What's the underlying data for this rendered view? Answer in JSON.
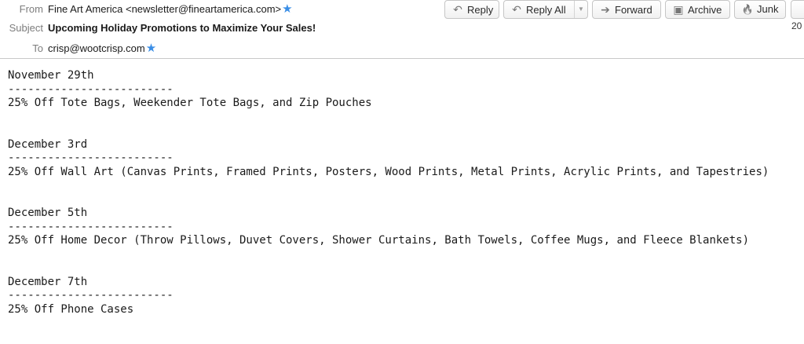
{
  "header": {
    "from_label": "From",
    "from_value": "Fine Art America <newsletter@fineartamerica.com>",
    "subject_label": "Subject",
    "subject_value": "Upcoming Holiday Promotions to Maximize Your Sales!",
    "to_label": "To",
    "to_value": "crisp@wootcrisp.com",
    "star_icon": "★",
    "date_fragment": "20",
    "accent_color": "#3a8ee6"
  },
  "toolbar": {
    "reply": {
      "label": "Reply",
      "icon": "reply-icon",
      "glyph": "↶"
    },
    "reply_all": {
      "label": "Reply All",
      "icon": "reply-all-icon",
      "glyph": "↶"
    },
    "forward": {
      "label": "Forward",
      "icon": "forward-icon",
      "glyph": "➔"
    },
    "archive": {
      "label": "Archive",
      "icon": "archive-icon",
      "glyph": "▣"
    },
    "junk": {
      "label": "Junk",
      "icon": "junk-flame-icon",
      "glyph": "🔥"
    }
  },
  "body": {
    "sections": [
      {
        "date": "November 29th",
        "rule": "-------------------------",
        "text": "25% Off Tote Bags, Weekender Tote Bags, and Zip Pouches"
      },
      {
        "date": "December 3rd",
        "rule": "-------------------------",
        "text": "25% Off Wall Art (Canvas Prints, Framed Prints, Posters, Wood Prints, Metal Prints, Acrylic Prints, and Tapestries)"
      },
      {
        "date": "December 5th",
        "rule": "-------------------------",
        "text": "25% Off Home Decor (Throw Pillows, Duvet Covers, Shower Curtains, Bath Towels, Coffee Mugs, and Fleece Blankets)"
      },
      {
        "date": "December 7th",
        "rule": "-------------------------",
        "text": "25% Off Phone Cases"
      }
    ]
  }
}
